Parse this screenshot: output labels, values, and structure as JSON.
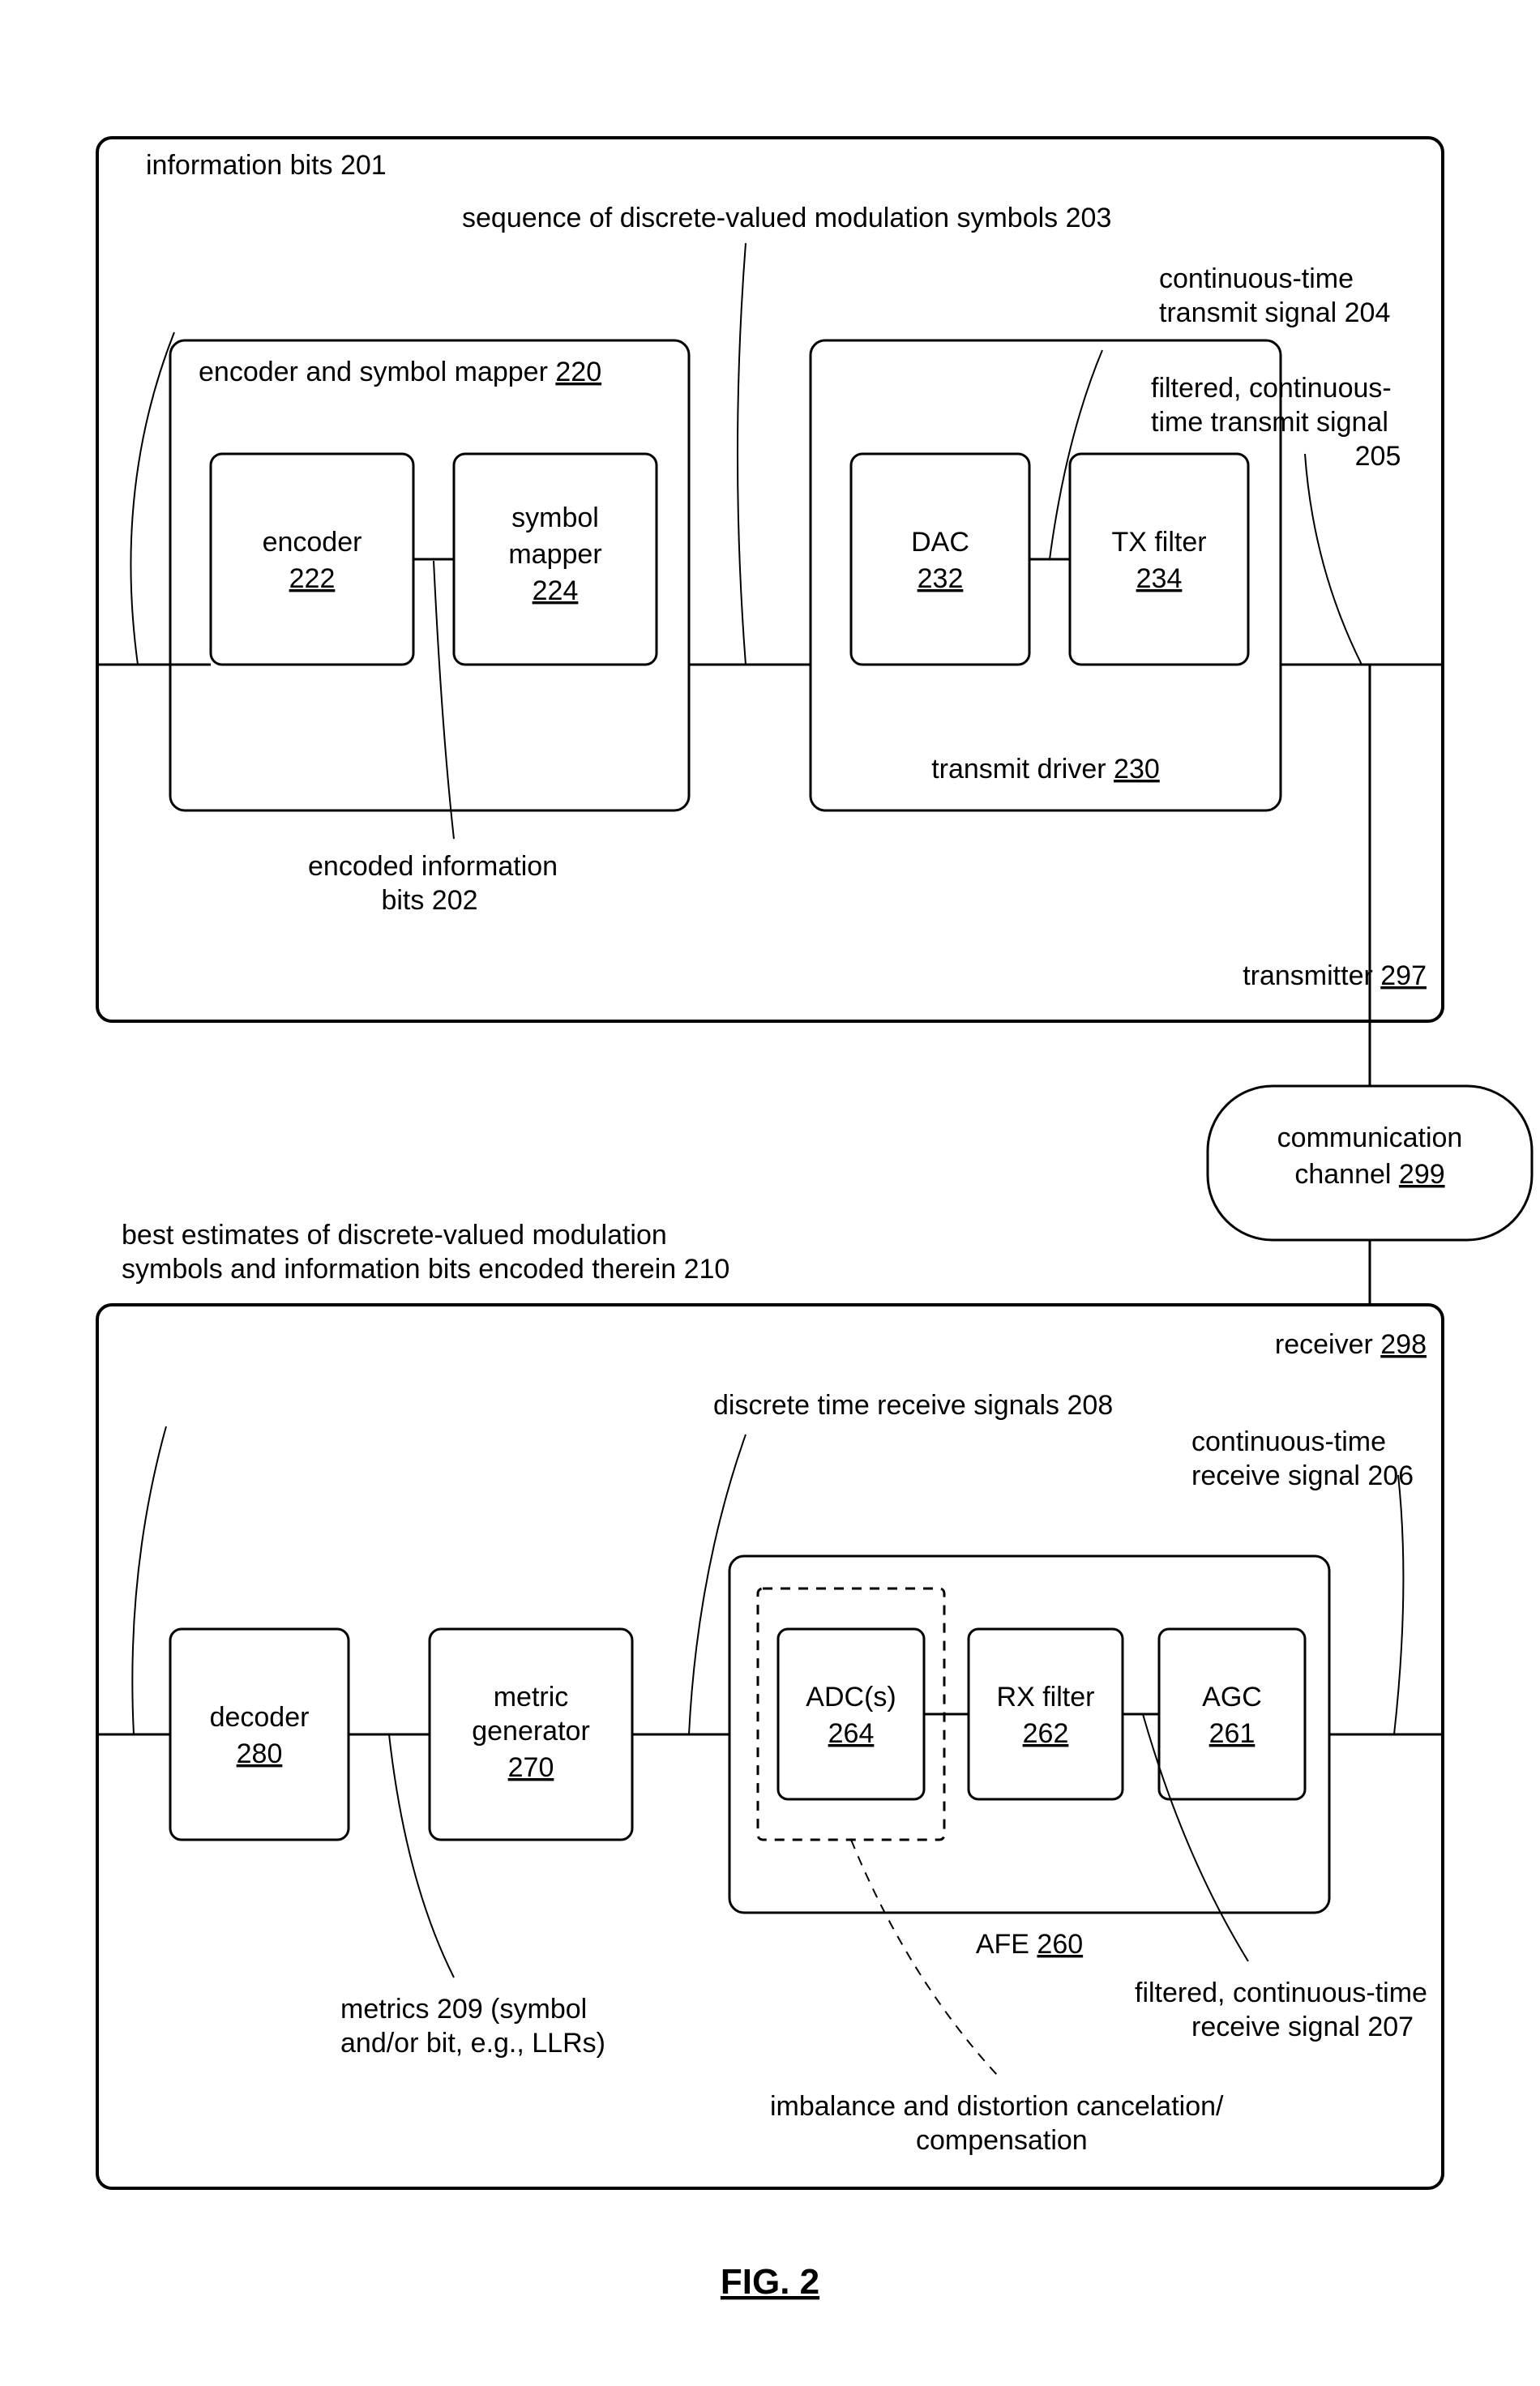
{
  "chart_data": {
    "type": "block-diagram",
    "figure": "FIG. 2",
    "transmitter": {
      "ref": "297",
      "label": "transmitter",
      "input_signal": {
        "ref": "201",
        "label": "information bits"
      },
      "blocks": {
        "encoder_symbol_mapper": {
          "ref": "220",
          "label": "encoder and symbol mapper"
        },
        "encoder": {
          "ref": "222",
          "label": "encoder"
        },
        "symbol_mapper": {
          "ref": "224",
          "label": "symbol mapper"
        },
        "transmit_driver": {
          "ref": "230",
          "label": "transmit driver"
        },
        "dac": {
          "ref": "232",
          "label": "DAC"
        },
        "tx_filter": {
          "ref": "234",
          "label": "TX filter"
        }
      },
      "signals": {
        "encoded_info_bits": {
          "ref": "202",
          "label_l1": "encoded information",
          "label_l2": "bits"
        },
        "discrete_mod_symbols": {
          "ref": "203",
          "label": "sequence of discrete-valued modulation symbols"
        },
        "ct_tx_signal": {
          "ref": "204",
          "label_l1": "continuous-time",
          "label_l2": "transmit signal"
        },
        "filtered_ct_tx_signal": {
          "ref": "205",
          "label_l1": "filtered, continuous-",
          "label_l2": "time transmit signal"
        }
      }
    },
    "channel": {
      "ref": "299",
      "label_l1": "communication",
      "label_l2": "channel"
    },
    "receiver": {
      "ref": "298",
      "label": "receiver",
      "blocks": {
        "afe": {
          "ref": "260",
          "label": "AFE"
        },
        "agc": {
          "ref": "261",
          "label": "AGC"
        },
        "rx_filter": {
          "ref": "262",
          "label": "RX filter"
        },
        "adc": {
          "ref": "264",
          "label": "ADC(s)"
        },
        "metric_generator": {
          "ref": "270",
          "label_l1": "metric",
          "label_l2": "generator"
        },
        "decoder": {
          "ref": "280",
          "label": "decoder"
        }
      },
      "signals": {
        "ct_rx": {
          "ref": "206",
          "label_l1": "continuous-time",
          "label_l2": "receive signal"
        },
        "filtered_ct_rx": {
          "ref": "207",
          "label_l1": "filtered, continuous-time",
          "label_l2": "receive signal"
        },
        "discrete_rx": {
          "ref": "208",
          "label": "discrete time receive signals"
        },
        "metrics": {
          "ref": "209",
          "label_l1": "metrics",
          "label_l2": "(symbol",
          "label_l3": "and/or bit, e.g., LLRs)"
        },
        "estimates": {
          "ref": "210",
          "label_l1": "best estimates of discrete-valued modulation",
          "label_l2": "symbols and information bits encoded therein"
        }
      },
      "note": {
        "label_l1": "imbalance and distortion cancelation/",
        "label_l2": "compensation"
      }
    }
  },
  "t_label": {
    "info_bits": "information bits 201",
    "enc_map": "encoder and symbol mapper",
    "enc_map_ref": "220",
    "encoder": "encoder",
    "encoder_ref": "222",
    "sym_map_l1": "symbol",
    "sym_map_l2": "mapper",
    "sym_map_ref": "224",
    "enc_bits_l1": "encoded information",
    "enc_bits_l2": "bits 202",
    "seq": "sequence of discrete-valued modulation symbols 203",
    "tx_driver": "transmit driver",
    "tx_driver_ref": "230",
    "dac": "DAC",
    "dac_ref": "232",
    "txf": "TX filter",
    "txf_ref": "234",
    "ct_tx_l1": "continuous-time",
    "ct_tx_l2": "transmit signal 204",
    "f_ct_tx_l1": "filtered, continuous-",
    "f_ct_tx_l2": "time transmit signal",
    "f_ct_tx_l3": "205",
    "transmitter": "transmitter",
    "transmitter_ref": "297",
    "chan_l1": "communication",
    "chan_l2": "channel",
    "chan_ref": "299",
    "receiver": "receiver",
    "receiver_ref": "298",
    "est_l1": "best estimates of discrete-valued modulation",
    "est_l2": "symbols and information bits encoded therein 210",
    "drx": "discrete time receive signals 208",
    "ct_rx_l1": "continuous-time",
    "ct_rx_l2": "receive signal 206",
    "decoder": "decoder",
    "decoder_ref": "280",
    "metric_l1": "metric",
    "metric_l2": "generator",
    "metric_ref": "270",
    "metrics_l1": "metrics 209 (symbol",
    "metrics_l2": "and/or bit, e.g., LLRs)",
    "adc": "ADC(s)",
    "adc_ref": "264",
    "rxf": "RX filter",
    "rxf_ref": "262",
    "agc": "AGC",
    "agc_ref": "261",
    "afe": "AFE",
    "afe_ref": "260",
    "f_ct_rx_l1": "filtered, continuous-time",
    "f_ct_rx_l2": "receive signal 207",
    "note_l1": "imbalance and distortion cancelation/",
    "note_l2": "compensation",
    "fig": "FIG. 2"
  }
}
